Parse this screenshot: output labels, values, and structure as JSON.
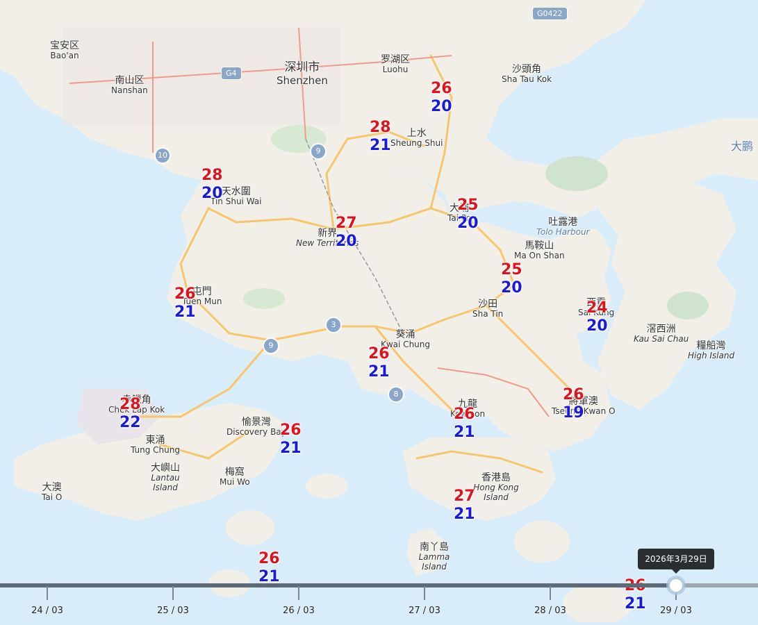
{
  "places": [
    {
      "key": "baoan",
      "zh": "宝安区",
      "en": "Bao'an"
    },
    {
      "key": "nanshan",
      "zh": "南山区",
      "en": "Nanshan"
    },
    {
      "key": "shenzhen",
      "zh": "深圳市",
      "en": "Shenzhen"
    },
    {
      "key": "luohu",
      "zh": "罗湖区",
      "en": "Luohu"
    },
    {
      "key": "shataukok",
      "zh": "沙頭角",
      "en": "Sha Tau Kok"
    },
    {
      "key": "sheungshui",
      "zh": "上水",
      "en": "Sheung Shui"
    },
    {
      "key": "tinshuiwai",
      "zh": "天水圍",
      "en": "Tin Shui Wai"
    },
    {
      "key": "newterritories",
      "zh": "新界",
      "en": "New Territories"
    },
    {
      "key": "taipo",
      "zh": "大埔",
      "en": "Tai Po"
    },
    {
      "key": "toloharbour",
      "zh": "吐露港",
      "en": "Tolo Harbour"
    },
    {
      "key": "maonshan",
      "zh": "馬鞍山",
      "en": "Ma On Shan"
    },
    {
      "key": "tuenmun",
      "zh": "屯門",
      "en": "Tuen Mun"
    },
    {
      "key": "shatin",
      "zh": "沙田",
      "en": "Sha Tin"
    },
    {
      "key": "saikung",
      "zh": "西貢",
      "en": "Sai Kung"
    },
    {
      "key": "kausaichau",
      "zh": "滘西洲",
      "en": "Kau Sai Chau"
    },
    {
      "key": "highisland",
      "zh": "糧船灣",
      "en": "High Island"
    },
    {
      "key": "kwaichung",
      "zh": "葵涌",
      "en": "Kwai Chung"
    },
    {
      "key": "chek",
      "zh": "赤鱲角",
      "en": "Chek Lap Kok"
    },
    {
      "key": "discovery",
      "zh": "愉景灣",
      "en": "Discovery Bay"
    },
    {
      "key": "kowloon",
      "zh": "九龍",
      "en": "Kowloon"
    },
    {
      "key": "tkowan",
      "zh": "將軍澳",
      "en": "Tseung Kwan O"
    },
    {
      "key": "tungchung",
      "zh": "東涌",
      "en": "Tung Chung"
    },
    {
      "key": "lantau",
      "zh": "大嶼山",
      "en": "Lantau Island"
    },
    {
      "key": "muiwo",
      "zh": "梅窩",
      "en": "Mui Wo"
    },
    {
      "key": "taio",
      "zh": "大澳",
      "en": "Tai O"
    },
    {
      "key": "hki",
      "zh": "香港島",
      "en": "Hong Kong Island"
    },
    {
      "key": "lamma",
      "zh": "南丫島",
      "en": "Lamma Island"
    },
    {
      "key": "dapeng",
      "zh": "大鹏",
      "en": ""
    }
  ],
  "shields": [
    "10",
    "9",
    "G4",
    "3",
    "9",
    "8"
  ],
  "highway": "G0422",
  "temps": [
    {
      "hi": "26",
      "lo": "20"
    },
    {
      "hi": "28",
      "lo": "21"
    },
    {
      "hi": "28",
      "lo": "20"
    },
    {
      "hi": "25",
      "lo": "20"
    },
    {
      "hi": "27",
      "lo": "20"
    },
    {
      "hi": "25",
      "lo": "20"
    },
    {
      "hi": "26",
      "lo": "21"
    },
    {
      "hi": "24",
      "lo": "20"
    },
    {
      "hi": "26",
      "lo": "21"
    },
    {
      "hi": "28",
      "lo": "22"
    },
    {
      "hi": "26",
      "lo": "21"
    },
    {
      "hi": "26",
      "lo": "21"
    },
    {
      "hi": "26",
      "lo": "19"
    },
    {
      "hi": "27",
      "lo": "21"
    },
    {
      "hi": "26",
      "lo": "21"
    },
    {
      "hi": "26",
      "lo": "21"
    }
  ],
  "timeline": {
    "labels": [
      "24 / 03",
      "25 / 03",
      "26 / 03",
      "27 / 03",
      "28 / 03",
      "29 / 03"
    ],
    "selected_tooltip": "2026年3月29日"
  },
  "colors": {
    "sea": "#d9ecfa",
    "land": "#f2efe9",
    "highTemp": "#e0121b",
    "lowTemp": "#1a1adb",
    "roads": "#f7c66b",
    "majorRoads": "#f09a8a"
  }
}
